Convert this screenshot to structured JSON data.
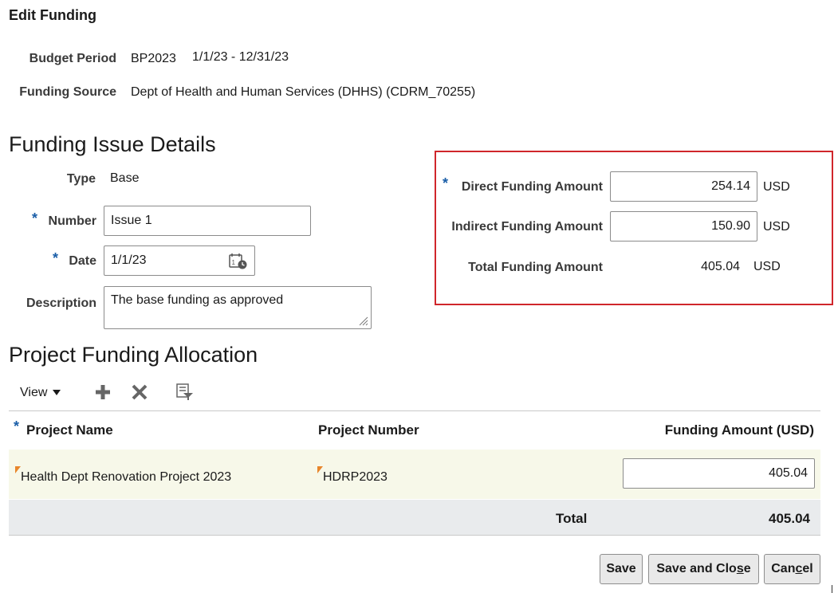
{
  "page": {
    "title": "Edit Funding"
  },
  "header": {
    "budget_period_label": "Budget Period",
    "budget_period_code": "BP2023",
    "budget_period_range": "1/1/23 - 12/31/23",
    "funding_source_label": "Funding Source",
    "funding_source_value": "Dept of Health and Human Services (DHHS) (CDRM_70255)"
  },
  "issue": {
    "heading": "Funding Issue Details",
    "type_label": "Type",
    "type_value": "Base",
    "number_label": "Number",
    "number_value": "Issue 1",
    "date_label": "Date",
    "date_value": "1/1/23",
    "description_label": "Description",
    "description_value": "The base funding as approved",
    "required_marker": "*"
  },
  "amounts": {
    "direct_label": "Direct Funding Amount",
    "direct_value": "254.14",
    "indirect_label": "Indirect Funding Amount",
    "indirect_value": "150.90",
    "total_label": "Total Funding Amount",
    "total_value": "405.04",
    "currency": "USD"
  },
  "allocation": {
    "heading": "Project Funding Allocation",
    "toolbar": {
      "view_label": "View"
    },
    "columns": {
      "project_name": "Project Name",
      "project_number": "Project Number",
      "funding_amount": "Funding Amount (USD)"
    },
    "rows": [
      {
        "project_name": "Health Dept Renovation Project 2023",
        "project_number": "HDRP2023",
        "funding_amount": "405.04"
      }
    ],
    "total_label": "Total",
    "total_value": "405.04"
  },
  "buttons": {
    "save": "Save",
    "save_close_prefix": "Save and Clo",
    "save_close_mnemonic": "s",
    "save_close_suffix": "e",
    "cancel_prefix": "Can",
    "cancel_mnemonic": "c",
    "cancel_suffix": "el"
  },
  "colors": {
    "highlight_border": "#d0262b",
    "required": "#1a5ea8",
    "row_highlight": "#f7f8e9",
    "flag": "#e8862b"
  }
}
